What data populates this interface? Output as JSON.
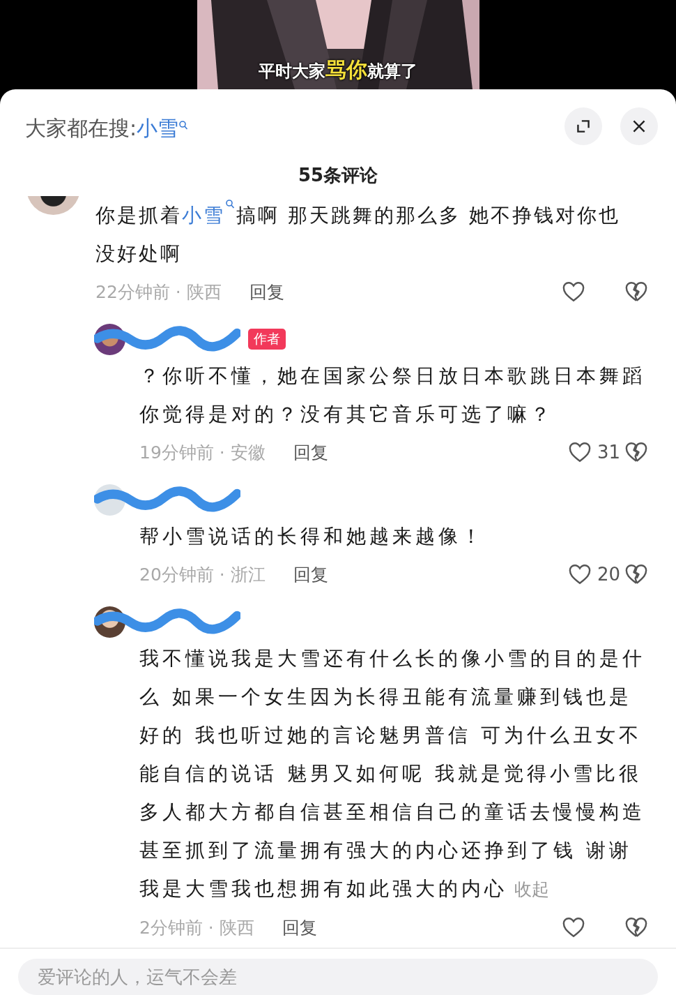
{
  "video": {
    "kind": "picture",
    "subtitle": [
      {
        "text": "平时大家",
        "highlight": false
      },
      {
        "text": "骂你",
        "highlight": true
      },
      {
        "text": "就算了",
        "highlight": false
      }
    ]
  },
  "header": {
    "trending_label": "大家都在搜:",
    "trending_keyword": "小雪"
  },
  "comment_count": "55条评论",
  "comments": [
    {
      "kind": "top",
      "text": [
        {
          "kind": "plain",
          "text": "你是抓着"
        },
        {
          "kind": "keyword",
          "text": "小雪"
        },
        {
          "kind": "plain",
          "text": "搞啊 那天跳舞的那么多 她不挣钱对你也没好处啊"
        }
      ],
      "time_place": "22分钟前 · 陕西",
      "reply": "回复"
    },
    {
      "kind": "reply",
      "author_badge": "作者",
      "text": [
        {
          "kind": "plain",
          "text": "？你听不懂，她在国家公祭日放日本歌跳日本舞蹈你觉得是对的？没有其它音乐可选了嘛？"
        }
      ],
      "time_place": "19分钟前 · 安徽",
      "reply": "回复",
      "likes": "31"
    },
    {
      "kind": "reply",
      "text": [
        {
          "kind": "plain",
          "text": "帮小雪说话的长得和她越来越像！"
        }
      ],
      "time_place": "20分钟前 · 浙江",
      "reply": "回复",
      "likes": "20"
    },
    {
      "kind": "reply",
      "text": [
        {
          "kind": "plain",
          "text": "我不懂说我是大雪还有什么长的像小雪的目的是什么 如果一个女生因为长得丑能有流量赚到钱也是好的 我也听过她的言论魅男普信 可为什么丑女不能自信的说话 魅男又如何呢 我就是觉得小雪比很多人都大方都自信甚至相信自己的童话去慢慢构造甚至抓到了流量拥有强大的内心还挣到了钱 谢谢我是大雪我也想拥有如此强大的内心"
        }
      ],
      "collapse": "收起",
      "time_place": "2分钟前 · 陕西",
      "reply": "回复"
    }
  ],
  "input": {
    "placeholder": "爱评论的人，运气不会差"
  }
}
